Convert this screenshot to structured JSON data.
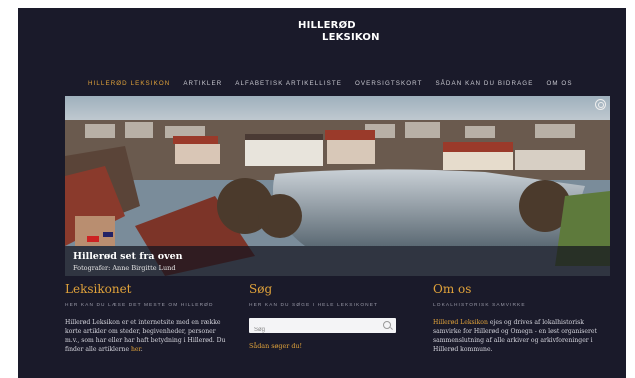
{
  "site": {
    "logo_line1": "HILLERØD",
    "logo_line2": "LEKSIKON"
  },
  "nav": {
    "items": [
      {
        "label": "HILLERØD LEKSIKON",
        "active": true
      },
      {
        "label": "ARTIKLER"
      },
      {
        "label": "ALFABETISK ARTIKELLISTE"
      },
      {
        "label": "OVERSIGTSKORT"
      },
      {
        "label": "SÅDAN KAN DU BIDRAGE"
      },
      {
        "label": "OM OS"
      }
    ]
  },
  "hero": {
    "title": "Hillerød set fra oven",
    "credit": "Fotografer: Anne Birgitte Lund"
  },
  "leksikonet": {
    "heading": "Leksikonet",
    "subheading": "HER KAN DU LÆSE DET MESTE OM HILLERØD",
    "body": "Hillerød Leksikon er et internetsite med en række korte artikler om steder, begivenheder, personer m.v., som har eller har haft betydning i Hillerød. Du finder alle artiklerne ",
    "link": "her",
    "tail": "."
  },
  "sog": {
    "heading": "Søg",
    "subheading": "HER KAN DU SØGE I HELE LEKSIKONET",
    "placeholder": "Søg",
    "value": "",
    "howto_link": "Sådan søger du!"
  },
  "omos": {
    "heading": "Om os",
    "subheading": "LOKALHISTORISK SAMVIRKE",
    "link": "Hillerød Leksikon",
    "body": " ejes og drives af lokalhistorisk samvirke for Hillerød og Omegn - en løst organiseret sammenslutning af alle arkiver og arkivforeninger i Hillerød kommune."
  },
  "colors": {
    "background": "#1a1a2a",
    "accent": "#e0a23a",
    "text": "#d4d4dc"
  },
  "icons": {
    "hero_button": "circle-target-icon",
    "search": "search-icon"
  }
}
